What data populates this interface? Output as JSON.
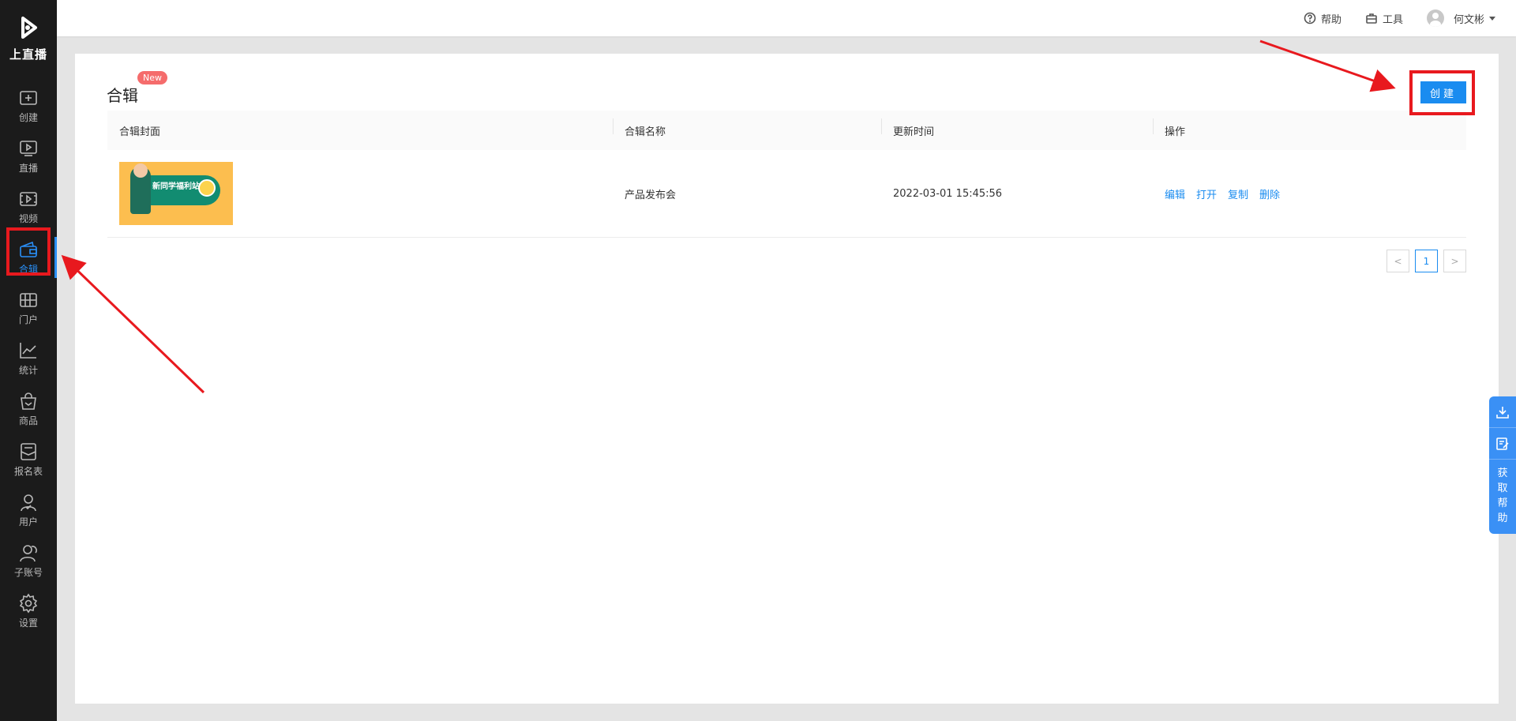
{
  "app": {
    "name": "上直播"
  },
  "sidebar": {
    "items": [
      {
        "label": "创建",
        "icon": "plus-square-icon"
      },
      {
        "label": "直播",
        "icon": "play-screen-icon"
      },
      {
        "label": "视频",
        "icon": "video-icon"
      },
      {
        "label": "合辑",
        "icon": "wallet-icon",
        "active": true
      },
      {
        "label": "门户",
        "icon": "grid-icon"
      },
      {
        "label": "统计",
        "icon": "chart-icon"
      },
      {
        "label": "商品",
        "icon": "bag-icon"
      },
      {
        "label": "报名表",
        "icon": "form-icon"
      },
      {
        "label": "用户",
        "icon": "user-icon"
      },
      {
        "label": "子账号",
        "icon": "users-icon"
      },
      {
        "label": "设置",
        "icon": "gear-icon"
      }
    ]
  },
  "topbar": {
    "help_label": "帮助",
    "tools_label": "工具",
    "user_name": "何文彬"
  },
  "main": {
    "title": "合辑",
    "badge": "New",
    "create_label": "创建",
    "table": {
      "headers": [
        "合辑封面",
        "合辑名称",
        "更新时间",
        "操作"
      ],
      "rows": [
        {
          "cover_text": "新同学福利站",
          "name": "产品发布会",
          "updated": "2022-03-01 15:45:56",
          "actions": [
            "编辑",
            "打开",
            "复制",
            "删除"
          ]
        }
      ]
    },
    "pagination": {
      "current": "1",
      "prev": "<",
      "next": ">"
    }
  },
  "help_widget": {
    "text": "获取帮助"
  },
  "colors": {
    "accent": "#1a8cf0",
    "sidebar_bg": "#1b1b1b",
    "annotation": "#e8191e"
  }
}
